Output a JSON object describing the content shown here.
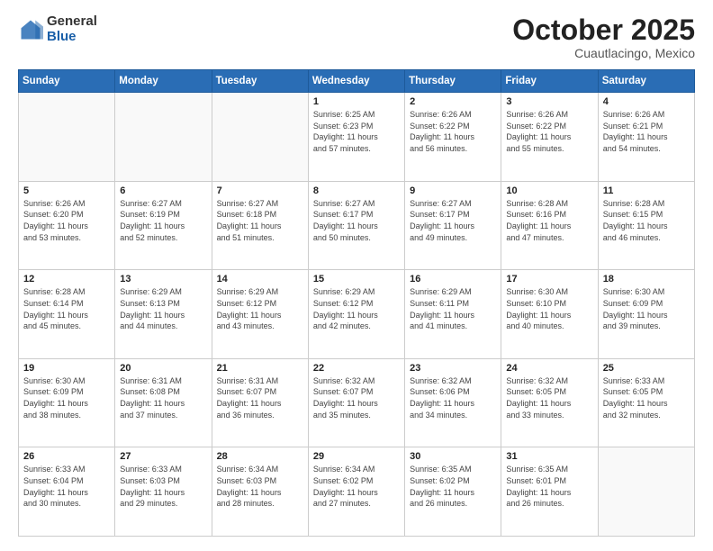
{
  "header": {
    "logo_general": "General",
    "logo_blue": "Blue",
    "month": "October 2025",
    "location": "Cuautlacingo, Mexico"
  },
  "weekdays": [
    "Sunday",
    "Monday",
    "Tuesday",
    "Wednesday",
    "Thursday",
    "Friday",
    "Saturday"
  ],
  "weeks": [
    [
      {
        "day": "",
        "info": ""
      },
      {
        "day": "",
        "info": ""
      },
      {
        "day": "",
        "info": ""
      },
      {
        "day": "1",
        "info": "Sunrise: 6:25 AM\nSunset: 6:23 PM\nDaylight: 11 hours\nand 57 minutes."
      },
      {
        "day": "2",
        "info": "Sunrise: 6:26 AM\nSunset: 6:22 PM\nDaylight: 11 hours\nand 56 minutes."
      },
      {
        "day": "3",
        "info": "Sunrise: 6:26 AM\nSunset: 6:22 PM\nDaylight: 11 hours\nand 55 minutes."
      },
      {
        "day": "4",
        "info": "Sunrise: 6:26 AM\nSunset: 6:21 PM\nDaylight: 11 hours\nand 54 minutes."
      }
    ],
    [
      {
        "day": "5",
        "info": "Sunrise: 6:26 AM\nSunset: 6:20 PM\nDaylight: 11 hours\nand 53 minutes."
      },
      {
        "day": "6",
        "info": "Sunrise: 6:27 AM\nSunset: 6:19 PM\nDaylight: 11 hours\nand 52 minutes."
      },
      {
        "day": "7",
        "info": "Sunrise: 6:27 AM\nSunset: 6:18 PM\nDaylight: 11 hours\nand 51 minutes."
      },
      {
        "day": "8",
        "info": "Sunrise: 6:27 AM\nSunset: 6:17 PM\nDaylight: 11 hours\nand 50 minutes."
      },
      {
        "day": "9",
        "info": "Sunrise: 6:27 AM\nSunset: 6:17 PM\nDaylight: 11 hours\nand 49 minutes."
      },
      {
        "day": "10",
        "info": "Sunrise: 6:28 AM\nSunset: 6:16 PM\nDaylight: 11 hours\nand 47 minutes."
      },
      {
        "day": "11",
        "info": "Sunrise: 6:28 AM\nSunset: 6:15 PM\nDaylight: 11 hours\nand 46 minutes."
      }
    ],
    [
      {
        "day": "12",
        "info": "Sunrise: 6:28 AM\nSunset: 6:14 PM\nDaylight: 11 hours\nand 45 minutes."
      },
      {
        "day": "13",
        "info": "Sunrise: 6:29 AM\nSunset: 6:13 PM\nDaylight: 11 hours\nand 44 minutes."
      },
      {
        "day": "14",
        "info": "Sunrise: 6:29 AM\nSunset: 6:12 PM\nDaylight: 11 hours\nand 43 minutes."
      },
      {
        "day": "15",
        "info": "Sunrise: 6:29 AM\nSunset: 6:12 PM\nDaylight: 11 hours\nand 42 minutes."
      },
      {
        "day": "16",
        "info": "Sunrise: 6:29 AM\nSunset: 6:11 PM\nDaylight: 11 hours\nand 41 minutes."
      },
      {
        "day": "17",
        "info": "Sunrise: 6:30 AM\nSunset: 6:10 PM\nDaylight: 11 hours\nand 40 minutes."
      },
      {
        "day": "18",
        "info": "Sunrise: 6:30 AM\nSunset: 6:09 PM\nDaylight: 11 hours\nand 39 minutes."
      }
    ],
    [
      {
        "day": "19",
        "info": "Sunrise: 6:30 AM\nSunset: 6:09 PM\nDaylight: 11 hours\nand 38 minutes."
      },
      {
        "day": "20",
        "info": "Sunrise: 6:31 AM\nSunset: 6:08 PM\nDaylight: 11 hours\nand 37 minutes."
      },
      {
        "day": "21",
        "info": "Sunrise: 6:31 AM\nSunset: 6:07 PM\nDaylight: 11 hours\nand 36 minutes."
      },
      {
        "day": "22",
        "info": "Sunrise: 6:32 AM\nSunset: 6:07 PM\nDaylight: 11 hours\nand 35 minutes."
      },
      {
        "day": "23",
        "info": "Sunrise: 6:32 AM\nSunset: 6:06 PM\nDaylight: 11 hours\nand 34 minutes."
      },
      {
        "day": "24",
        "info": "Sunrise: 6:32 AM\nSunset: 6:05 PM\nDaylight: 11 hours\nand 33 minutes."
      },
      {
        "day": "25",
        "info": "Sunrise: 6:33 AM\nSunset: 6:05 PM\nDaylight: 11 hours\nand 32 minutes."
      }
    ],
    [
      {
        "day": "26",
        "info": "Sunrise: 6:33 AM\nSunset: 6:04 PM\nDaylight: 11 hours\nand 30 minutes."
      },
      {
        "day": "27",
        "info": "Sunrise: 6:33 AM\nSunset: 6:03 PM\nDaylight: 11 hours\nand 29 minutes."
      },
      {
        "day": "28",
        "info": "Sunrise: 6:34 AM\nSunset: 6:03 PM\nDaylight: 11 hours\nand 28 minutes."
      },
      {
        "day": "29",
        "info": "Sunrise: 6:34 AM\nSunset: 6:02 PM\nDaylight: 11 hours\nand 27 minutes."
      },
      {
        "day": "30",
        "info": "Sunrise: 6:35 AM\nSunset: 6:02 PM\nDaylight: 11 hours\nand 26 minutes."
      },
      {
        "day": "31",
        "info": "Sunrise: 6:35 AM\nSunset: 6:01 PM\nDaylight: 11 hours\nand 26 minutes."
      },
      {
        "day": "",
        "info": ""
      }
    ]
  ]
}
